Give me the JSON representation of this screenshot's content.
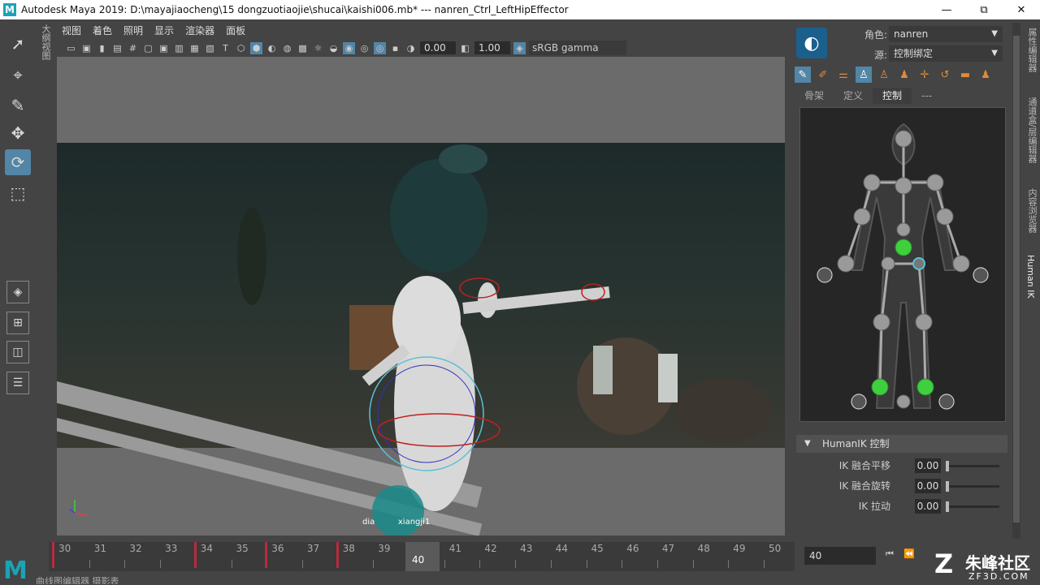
{
  "window": {
    "title": "Autodesk Maya 2019: D:\\mayajiaocheng\\15 dongzuotiaojie\\shucai\\kaishi006.mb*   ---   nanren_Ctrl_LeftHipEffector",
    "app_icon": "M",
    "min": "—",
    "max": "⧉",
    "close": "✕"
  },
  "left_vertical_tab": "大纲视图",
  "viewport": {
    "menu": [
      "视图",
      "着色",
      "照明",
      "显示",
      "渲染器",
      "面板"
    ],
    "exposure": "0.00",
    "gamma": "1.00",
    "color_space": "sRGB gamma",
    "object_label": "dianyingxiangji1",
    "object_label_visible": "dia",
    "object_label_visible2": "xiangji1"
  },
  "hik": {
    "character_label": "角色:",
    "character_value": "nanren",
    "source_label": "源:",
    "source_value": "控制绑定",
    "tabs": [
      "骨架",
      "定义",
      "控制",
      "---"
    ],
    "active_tab": "控制",
    "controls_header": "HumanIK 控制",
    "sliders": [
      {
        "label": "IK 融合平移",
        "value": "0.00",
        "level": 0.0
      },
      {
        "label": "IK 融合旋转",
        "value": "0.00",
        "level": 0.0
      },
      {
        "label": "IK 拉动",
        "value": "0.00",
        "level": 0.0
      }
    ]
  },
  "right_vertical_tabs": [
    "属性编辑器",
    "通道盒/层编辑器",
    "内容浏览器",
    "Human IK"
  ],
  "timeline": {
    "frames": [
      "30",
      "31",
      "32",
      "33",
      "34",
      "35",
      "36",
      "37",
      "38",
      "39",
      "40",
      "41",
      "42",
      "43",
      "44",
      "45",
      "46",
      "47",
      "48",
      "49",
      "50"
    ],
    "current_frame": "40",
    "frame_input": "40",
    "keyframes": [
      30,
      34,
      36,
      38,
      40
    ]
  },
  "bottom_tabs": "曲线图编辑器    摄影表",
  "watermark": {
    "glyph": "Z",
    "name": "朱峰社区",
    "domain": "ZF3D.COM"
  },
  "colors": {
    "accent": "#5285a6",
    "maya_teal": "#1aa3b5",
    "key_red": "#b82a3e",
    "ik_green": "#3fcf3f"
  }
}
